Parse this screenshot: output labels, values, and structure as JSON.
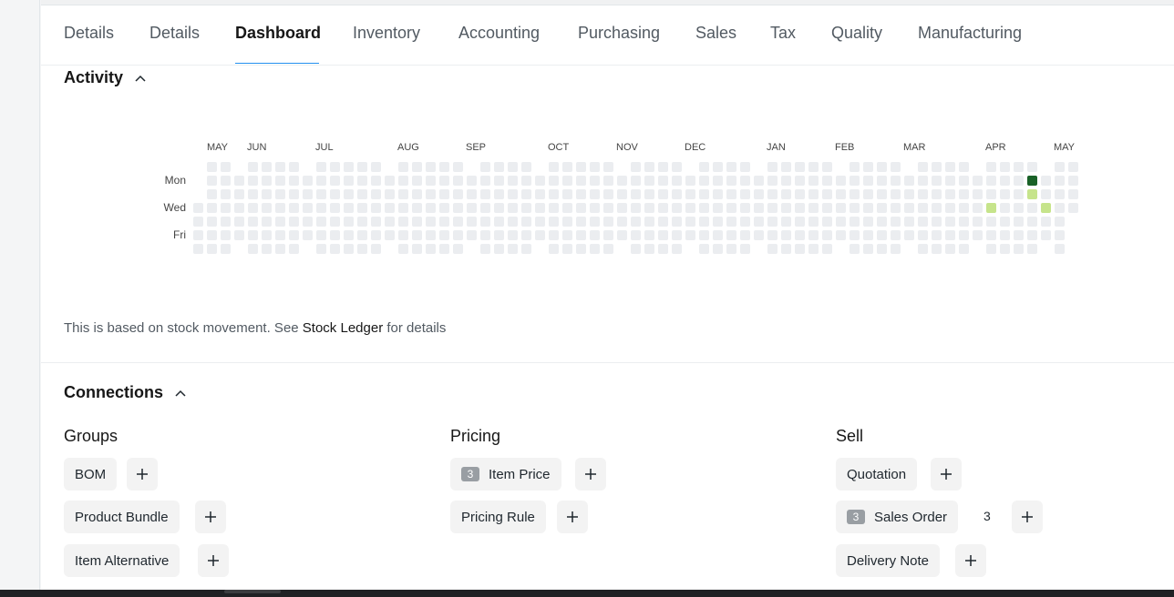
{
  "tabs": [
    {
      "label": "Details"
    },
    {
      "label": "Details"
    },
    {
      "label": "Dashboard",
      "active": true
    },
    {
      "label": "Inventory"
    },
    {
      "label": "Accounting"
    },
    {
      "label": "Purchasing"
    },
    {
      "label": "Sales"
    },
    {
      "label": "Tax"
    },
    {
      "label": "Quality"
    },
    {
      "label": "Manufacturing"
    }
  ],
  "activity": {
    "title": "Activity",
    "months": [
      "MAY",
      "JUN",
      "JUL",
      "AUG",
      "SEP",
      "OCT",
      "NOV",
      "DEC",
      "JAN",
      "FEB",
      "MAR",
      "APR",
      "MAY"
    ],
    "days": [
      "Mon",
      "Wed",
      "Fri"
    ],
    "colors": {
      "empty": "#ebedf0",
      "light": "#c6e48b",
      "dark": "#196127"
    },
    "highlights": [
      {
        "week": 61,
        "day": 1,
        "level": "dark"
      },
      {
        "week": 61,
        "day": 2,
        "level": "light"
      },
      {
        "week": 58,
        "day": 3,
        "level": "light"
      },
      {
        "week": 62,
        "day": 3,
        "level": "light"
      }
    ]
  },
  "note": {
    "prefix": "This is based on stock movement. See ",
    "link": "Stock Ledger",
    "suffix": " for details"
  },
  "connections": {
    "title": "Connections",
    "groups": {
      "title": "Groups",
      "items": [
        {
          "label": "BOM"
        },
        {
          "label": "Product Bundle"
        },
        {
          "label": "Item Alternative"
        }
      ]
    },
    "pricing": {
      "title": "Pricing",
      "items": [
        {
          "label": "Item Price",
          "count": "3"
        },
        {
          "label": "Pricing Rule"
        }
      ]
    },
    "sell": {
      "title": "Sell",
      "items": [
        {
          "label": "Quotation"
        },
        {
          "label": "Sales Order",
          "count": "3",
          "side_count": "3"
        },
        {
          "label": "Delivery Note"
        }
      ]
    }
  }
}
